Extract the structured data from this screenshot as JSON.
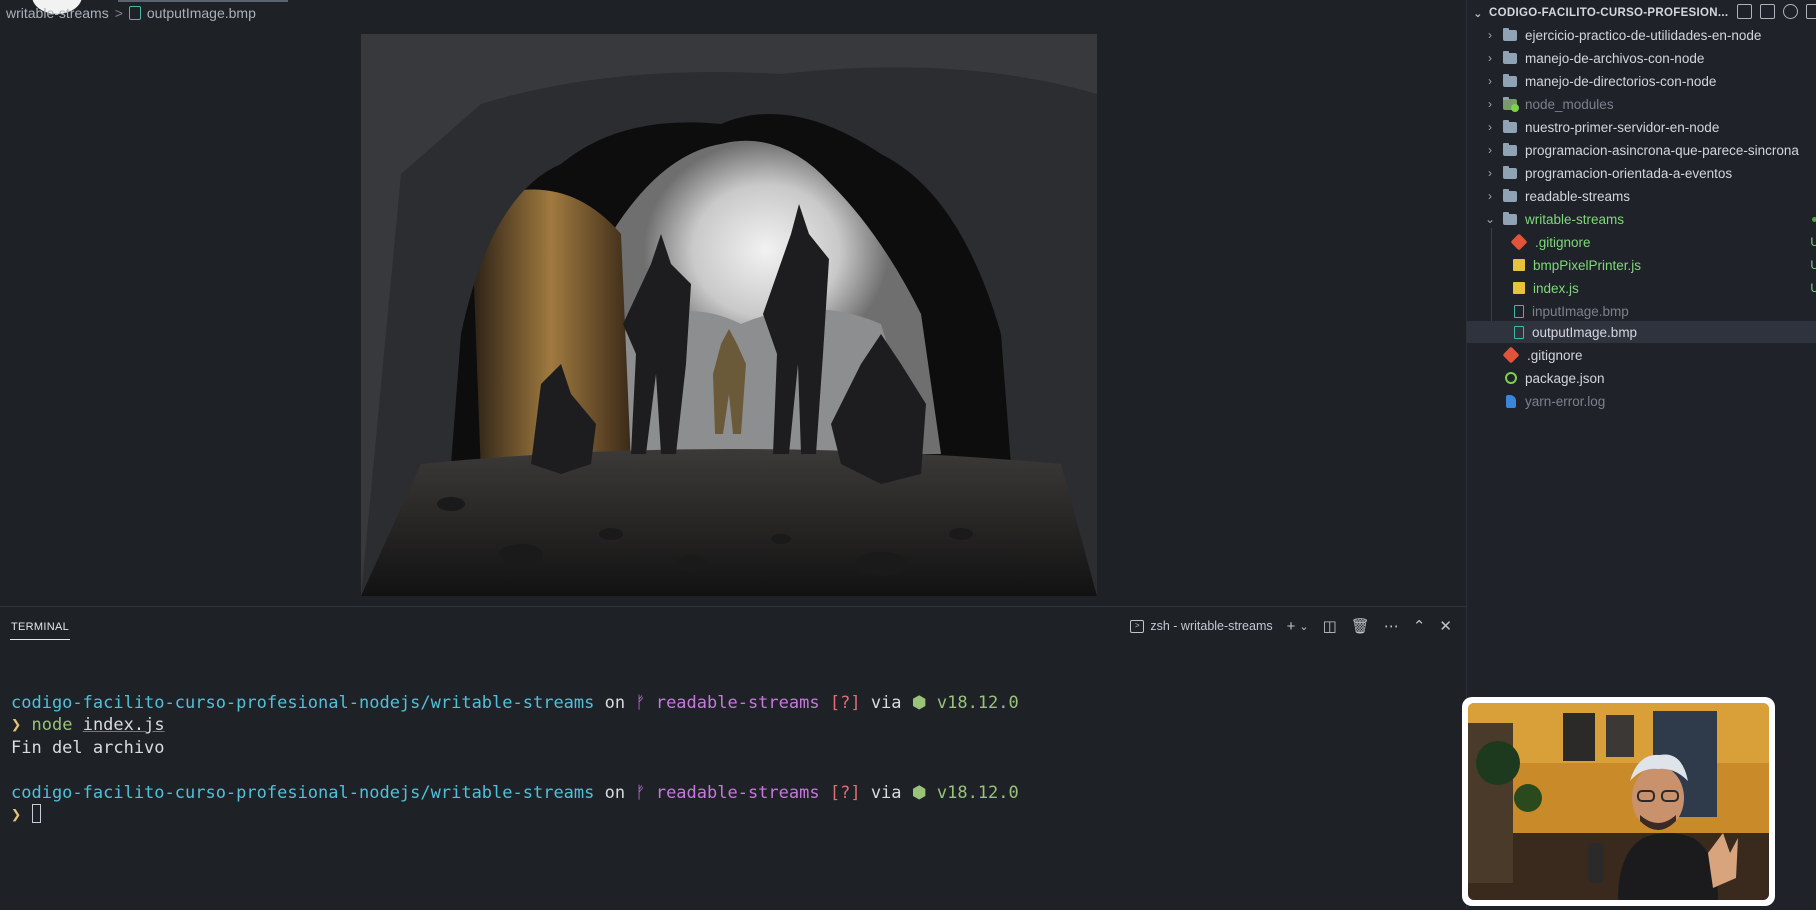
{
  "breadcrumb": {
    "folder": "writable-streams",
    "separator": ">",
    "file": "outputImage.bmp",
    "file_icon": "bmp-file-icon"
  },
  "image_viewer": {
    "alt": "cave scene with armored figures"
  },
  "explorer": {
    "root": "CODIGO-FACILITO-CURSO-PROFESION...",
    "actions": [
      "new-file-icon",
      "new-folder-icon",
      "refresh-icon",
      "collapse-icon"
    ],
    "items": [
      {
        "label": "ejercicio-practico-de-utilidades-en-node",
        "type": "folder"
      },
      {
        "label": "manejo-de-archivos-con-node",
        "type": "folder"
      },
      {
        "label": "manejo-de-directorios-con-node",
        "type": "folder"
      },
      {
        "label": "node_modules",
        "type": "folder"
      },
      {
        "label": "nuestro-primer-servidor-en-node",
        "type": "folder"
      },
      {
        "label": "programacion-asincrona-que-parece-sincrona",
        "type": "folder"
      },
      {
        "label": "programacion-orientada-a-eventos",
        "type": "folder"
      },
      {
        "label": "readable-streams",
        "type": "folder"
      },
      {
        "label": "writable-streams",
        "type": "folder-open"
      },
      {
        "label": ".gitignore",
        "type": "git",
        "badge": "U"
      },
      {
        "label": "bmpPixelPrinter.js",
        "type": "js",
        "badge": "U"
      },
      {
        "label": "index.js",
        "type": "js",
        "badge": "U"
      },
      {
        "label": "inputImage.bmp",
        "type": "bmp"
      },
      {
        "label": "outputImage.bmp",
        "type": "bmp"
      },
      {
        "label": ".gitignore",
        "type": "git"
      },
      {
        "label": "package.json",
        "type": "json"
      },
      {
        "label": "yarn-error.log",
        "type": "log"
      }
    ]
  },
  "panel": {
    "tab": "TERMINAL",
    "terminal_name": "zsh - writable-streams",
    "tools": [
      "plus-icon",
      "chevron-down-icon",
      "split-icon",
      "trash-icon",
      "more-icon",
      "maximize-icon",
      "close-icon"
    ]
  },
  "terminal": {
    "path": "codigo-facilito-curso-profesional-nodejs/writable-streams",
    "on": "on",
    "branch_glyph": "ᚠ",
    "branch": "readable-streams",
    "status": "[?]",
    "via": "via",
    "node_glyph": "⬢",
    "node_version": "v18.12.0",
    "prompt": "❯",
    "command": "node",
    "arg": "index.js",
    "output": "Fin del archivo"
  },
  "colors": {
    "path": "#4fc1d9",
    "branch": "#c678dd",
    "status": "#e06c75",
    "version": "#98c379",
    "git_untracked": "#7fd87a"
  }
}
